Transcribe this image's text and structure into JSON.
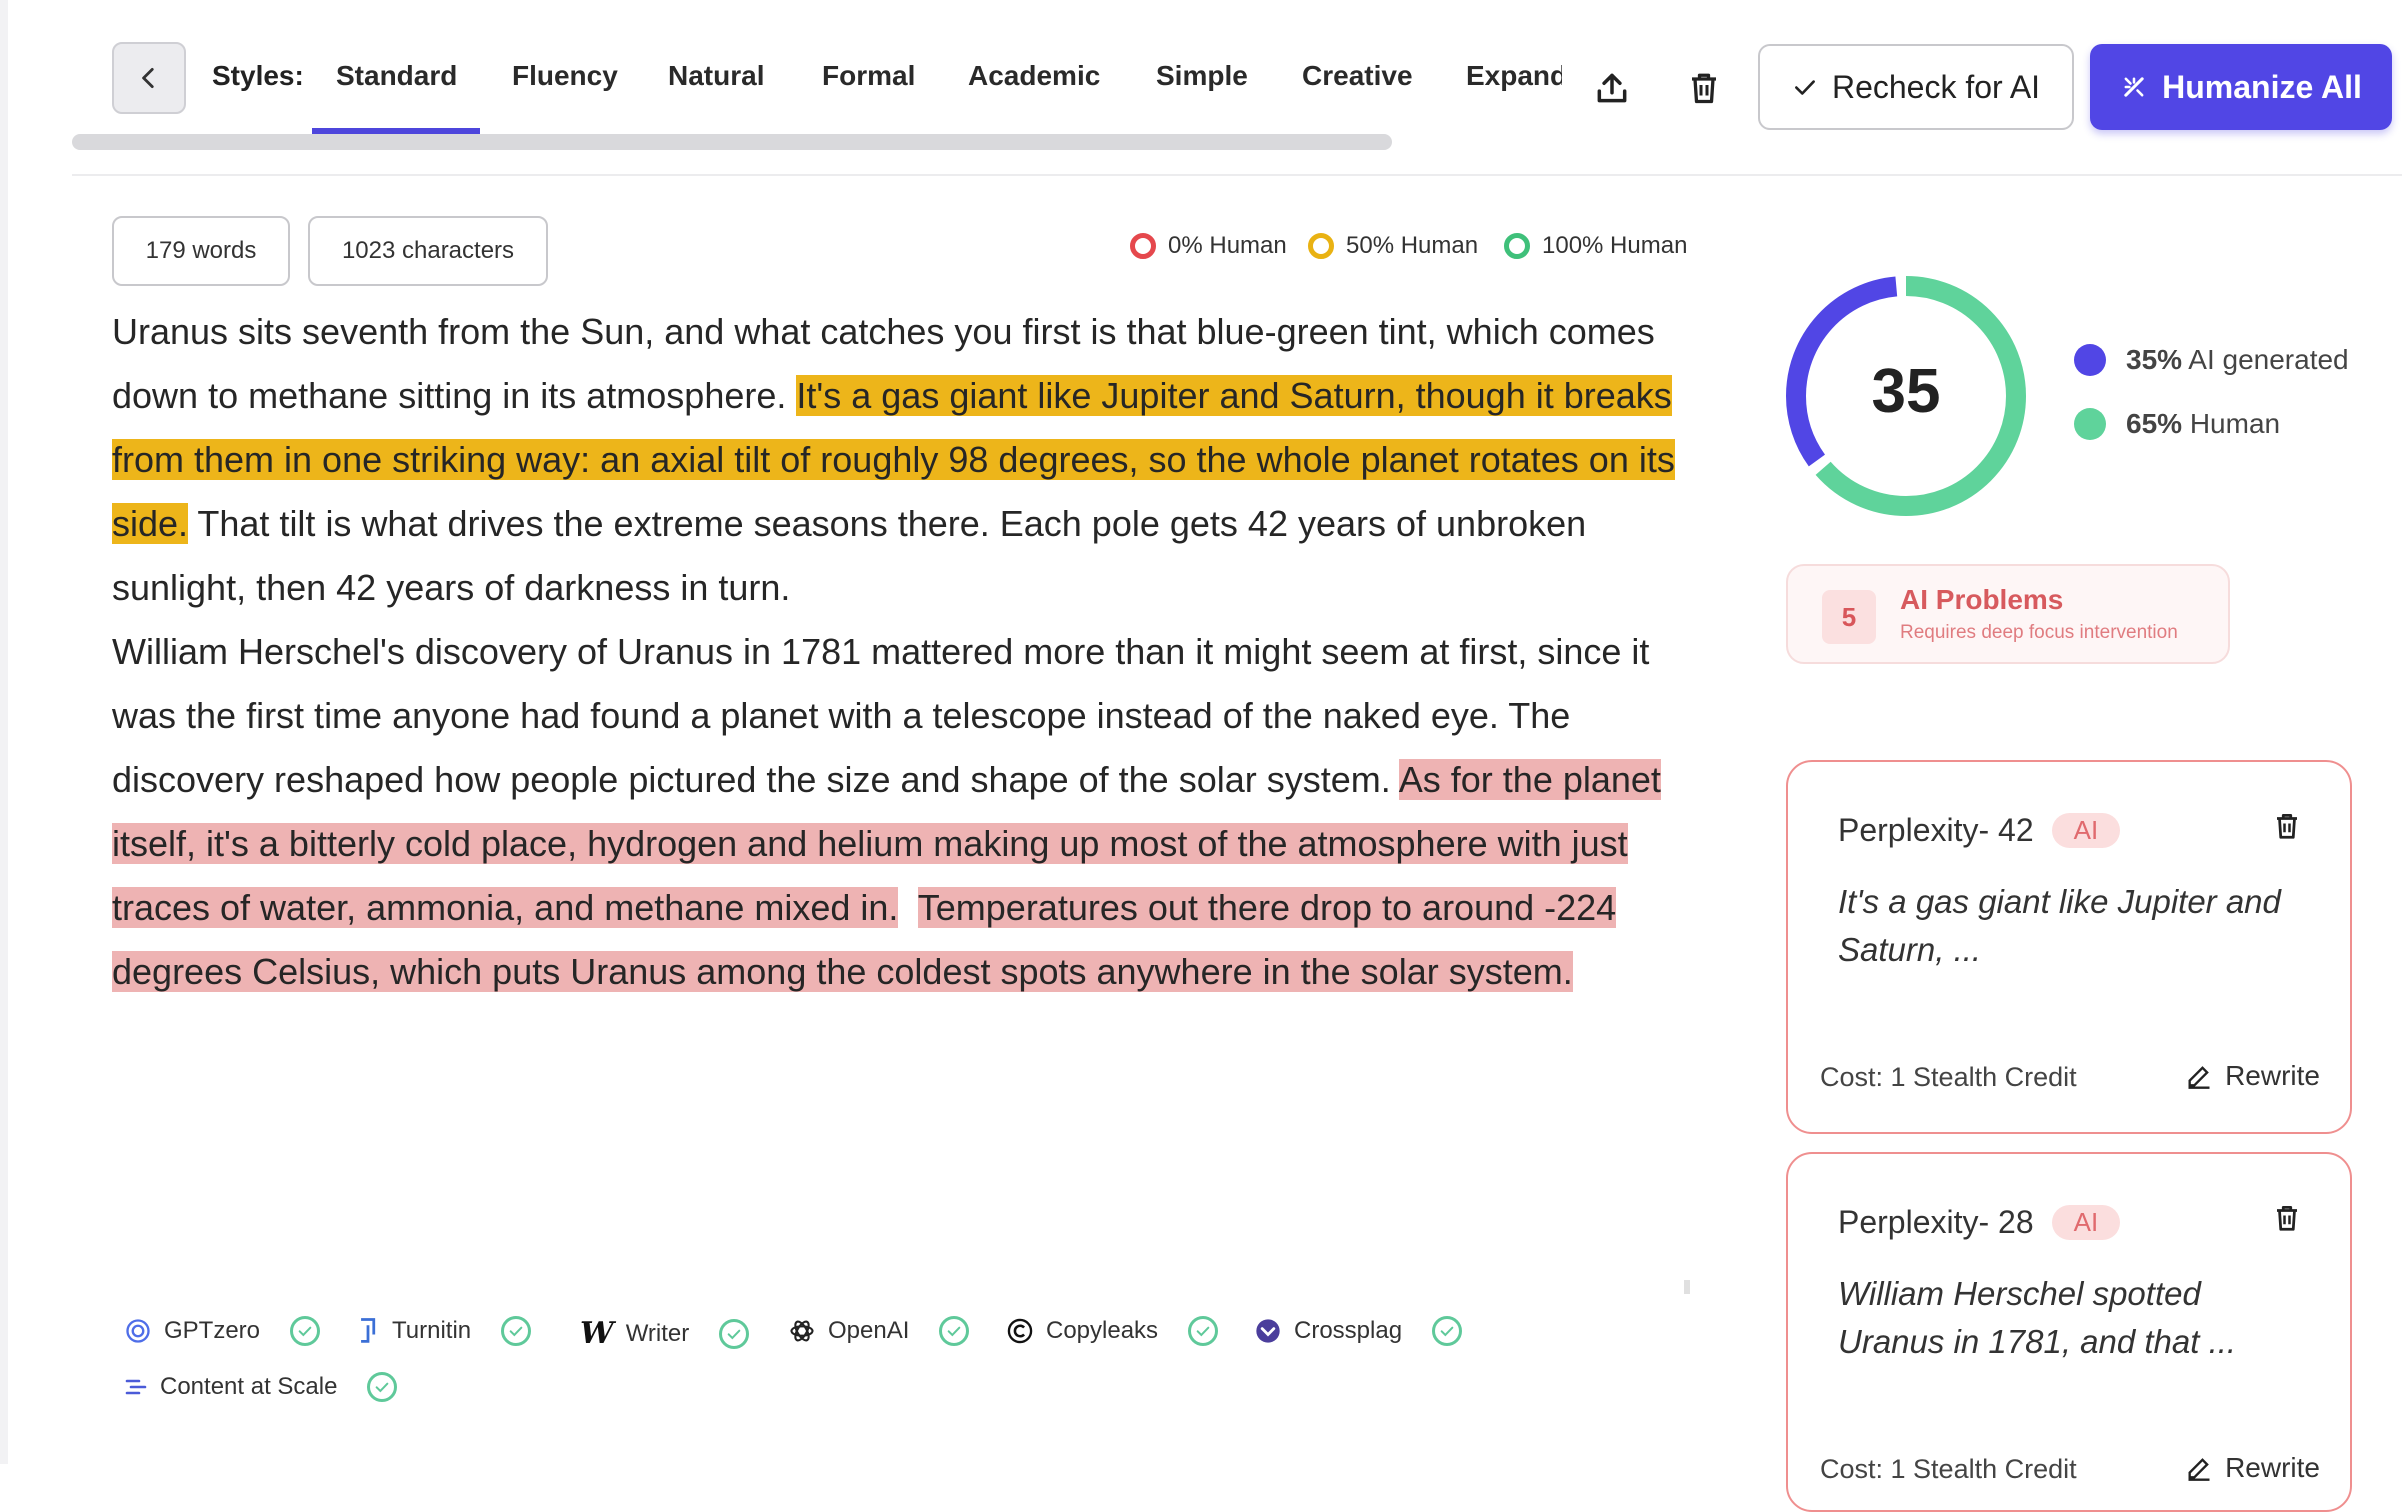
{
  "toolbar": {
    "styles_label": "Styles:",
    "tabs": [
      {
        "label": "Standard",
        "active": true
      },
      {
        "label": "Fluency"
      },
      {
        "label": "Natural"
      },
      {
        "label": "Formal"
      },
      {
        "label": "Academic"
      },
      {
        "label": "Simple"
      },
      {
        "label": "Creative"
      },
      {
        "label": "Expand"
      }
    ],
    "recheck_label": "Recheck for AI",
    "humanize_label": "Humanize All",
    "accent_color": "#5146e5"
  },
  "stats": {
    "words": "179 words",
    "characters": "1023 characters"
  },
  "legend": {
    "zero": "0% Human",
    "fifty": "50% Human",
    "hundred": "100% Human"
  },
  "text": {
    "p1_a": "Uranus sits seventh from the Sun, and what catches you first is that blue-green tint, which comes down to methane sitting in its atmosphere. ",
    "p1_hl": "It's a gas giant like Jupiter and Saturn, though it breaks from them in one striking way: an axial tilt of roughly 98 degrees, so the whole planet rotates on its side.",
    "p1_b": " That tilt is what drives the extreme seasons there. Each pole gets 42 years of unbroken sunlight, then 42 years of darkness in turn.",
    "p2_a": "William Herschel's discovery of Uranus in 1781 mattered more than it might seem at first, since it was the first time anyone had found a planet with a telescope instead of the naked eye. The discovery reshaped how people pictured the size and shape of the solar system. ",
    "p2_hl1": "As for the planet itself, it's a bitterly cold place, hydrogen and helium making up most of the atmosphere with just traces of water, ammonia, and methane mixed in.",
    "p2_hl2": "Temperatures out there drop to around -224 degrees Celsius, which puts Uranus among the coldest spots anywhere in the solar system."
  },
  "detectors": [
    "GPTzero",
    "Turnitin",
    "Writer",
    "OpenAI",
    "Copyleaks",
    "Crossplag",
    "Content at Scale"
  ],
  "score": {
    "value": "35",
    "ai_percent": 35,
    "ai_pct_label": "35%",
    "ai_label": "AI generated",
    "human_pct_label": "65%",
    "human_label": "Human",
    "ai_color": "#5146e5",
    "human_color": "#5fd39b"
  },
  "problems": {
    "count": "5",
    "title": "AI Problems",
    "subtitle": "Requires deep focus intervention"
  },
  "cards": [
    {
      "title": "Perplexity- 42",
      "badge": "AI",
      "excerpt": "It's a gas giant like Jupiter and Saturn, ...",
      "cost": "Cost: 1 Stealth Credit",
      "rewrite": "Rewrite"
    },
    {
      "title": "Perplexity- 28",
      "badge": "AI",
      "excerpt": "William Herschel spotted Uranus in 1781, and that ...",
      "cost": "Cost: 1 Stealth Credit",
      "rewrite": "Rewrite"
    }
  ]
}
